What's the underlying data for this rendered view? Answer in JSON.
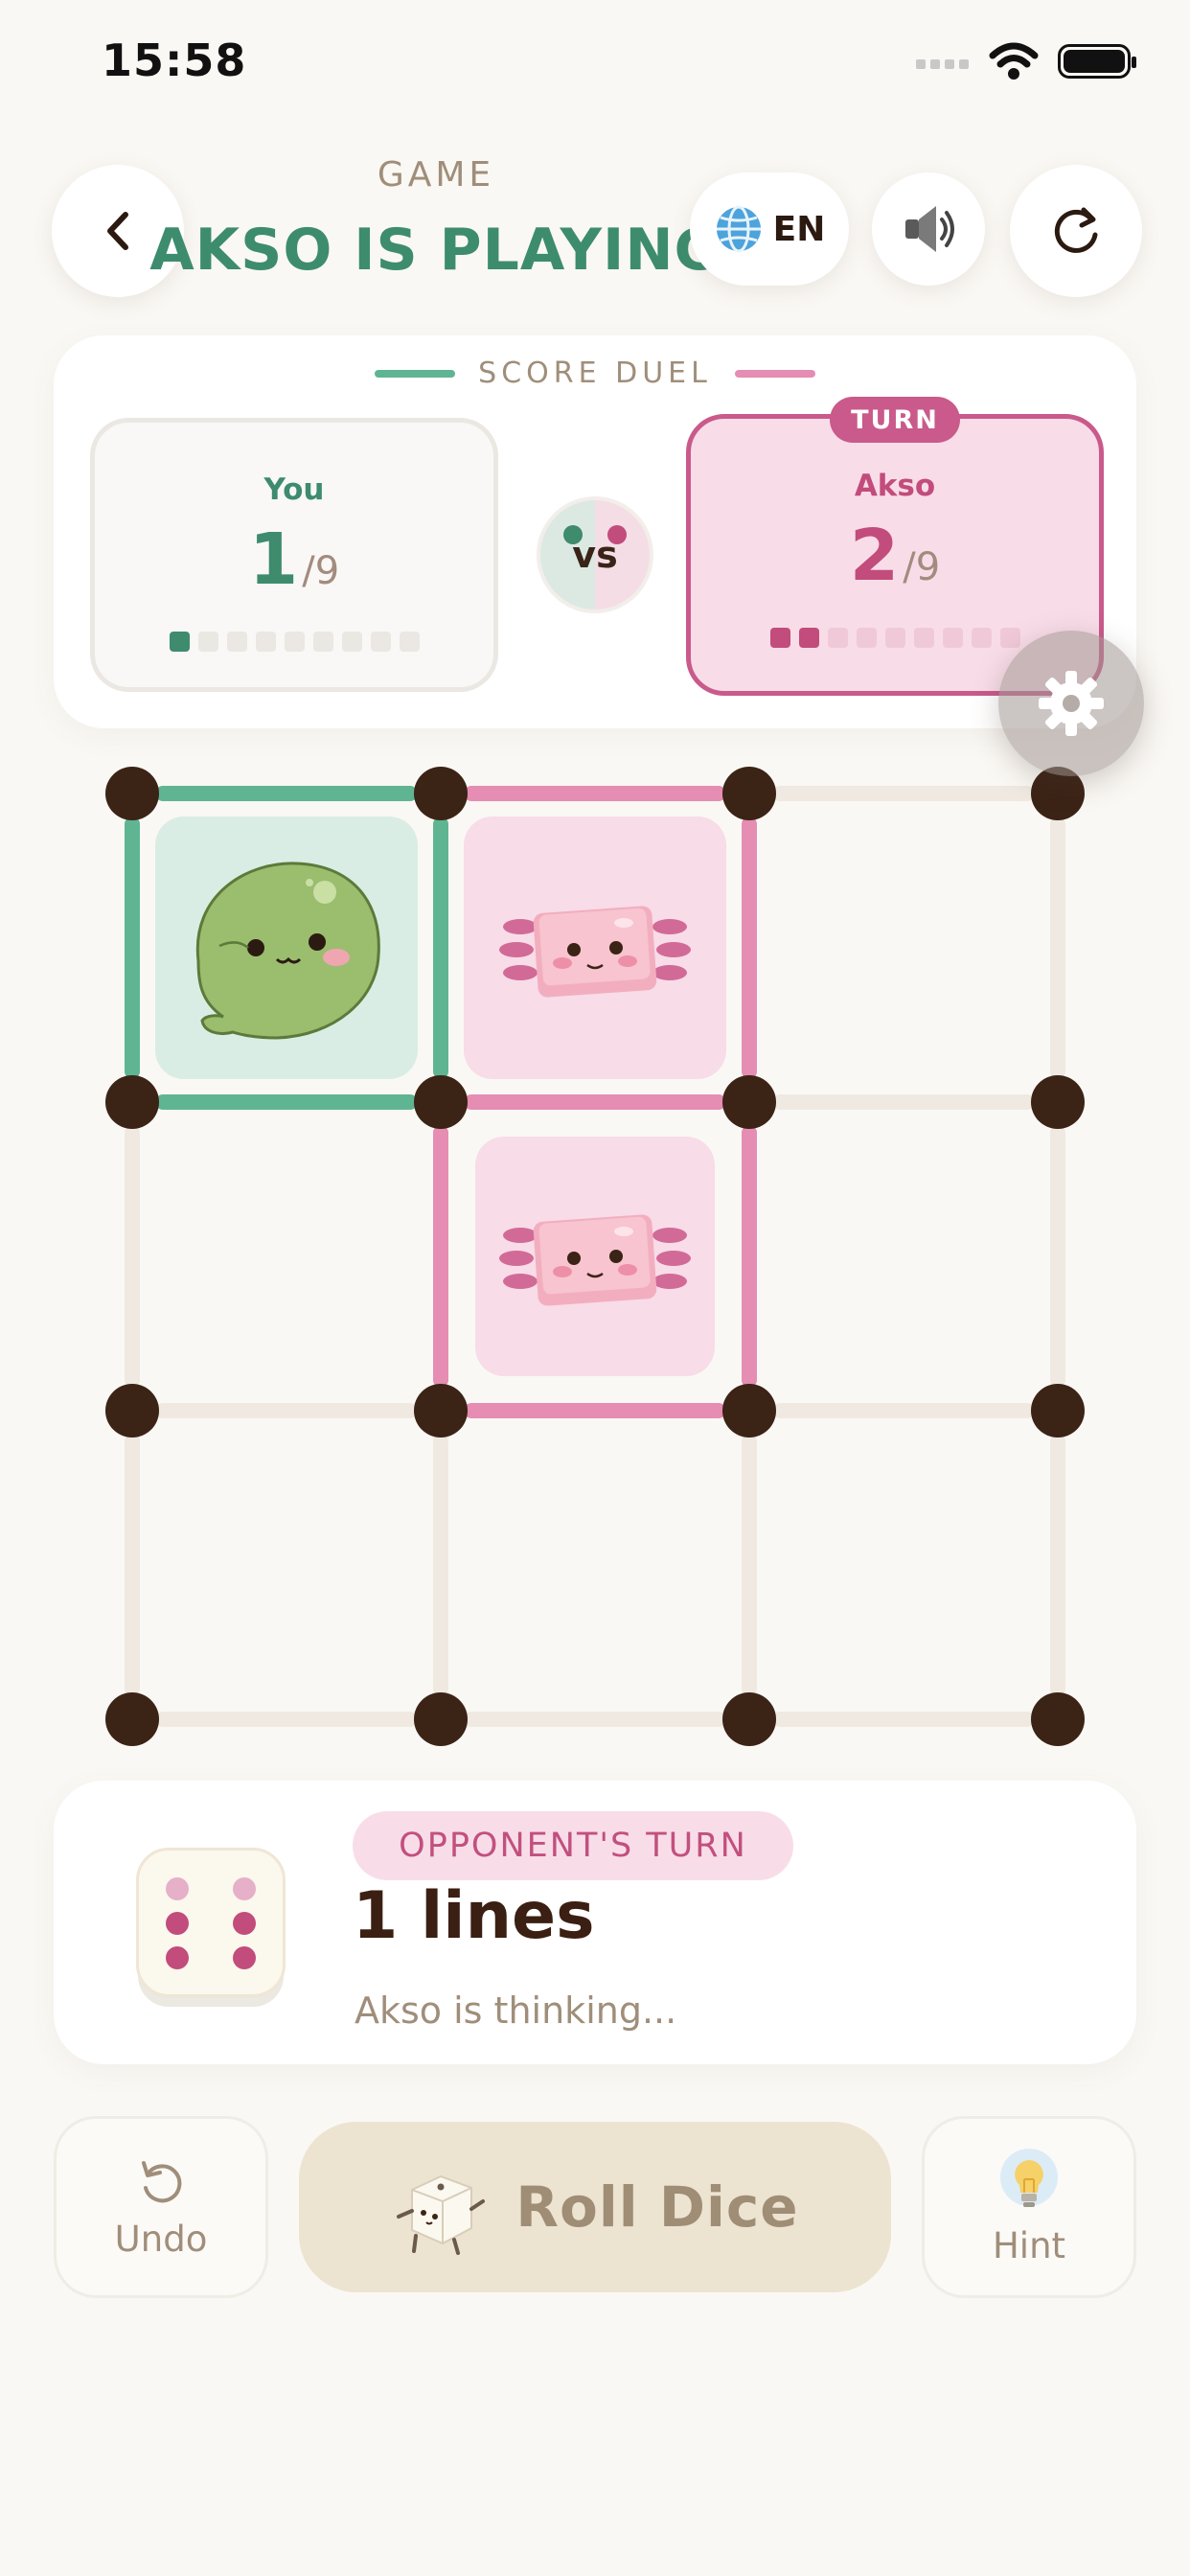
{
  "status_bar": {
    "time": "15:58"
  },
  "header": {
    "subtitle": "GAME",
    "title": "AKSO IS PLAYING",
    "language": "EN"
  },
  "score_card": {
    "label": "SCORE DUEL",
    "vs": "vs",
    "turn_badge": "TURN",
    "players": [
      {
        "name": "You",
        "score": "1",
        "total": "/9",
        "boxes": 9,
        "filled": 1,
        "color": "#3e8b6e"
      },
      {
        "name": "Akso",
        "score": "2",
        "total": "/9",
        "boxes": 9,
        "filled": 2,
        "color": "#c24c7c"
      }
    ]
  },
  "board": {
    "grid_dots": 4,
    "colors": {
      "you_line": "#5fb592",
      "akso_line": "#e58db3",
      "empty_line": "#efe9e1",
      "dot": "#3b2316",
      "you_fill": "#d9ede4",
      "akso_fill": "#f8dce8"
    },
    "h_lines": [
      [
        "you",
        "akso",
        "empty"
      ],
      [
        "you",
        "akso",
        "empty"
      ],
      [
        "empty",
        "akso",
        "empty"
      ],
      [
        "empty",
        "empty",
        "empty"
      ]
    ],
    "v_lines": [
      [
        "you",
        "you",
        "akso",
        "empty"
      ],
      [
        "empty",
        "akso",
        "akso",
        "empty"
      ],
      [
        "empty",
        "empty",
        "empty",
        "empty"
      ]
    ],
    "boxes": [
      {
        "row": 0,
        "col": 0,
        "owner": "you",
        "avatar": "green-blob-icon"
      },
      {
        "row": 0,
        "col": 1,
        "owner": "akso",
        "avatar": "axolotl-icon"
      },
      {
        "row": 1,
        "col": 1,
        "owner": "akso",
        "avatar": "axolotl-icon"
      }
    ]
  },
  "status_panel": {
    "pill": "OPPONENT'S TURN",
    "dice_value": 6,
    "lines": "1 lines",
    "message": "Akso is thinking..."
  },
  "actions": {
    "undo": "Undo",
    "roll": "Roll Dice",
    "hint": "Hint"
  }
}
